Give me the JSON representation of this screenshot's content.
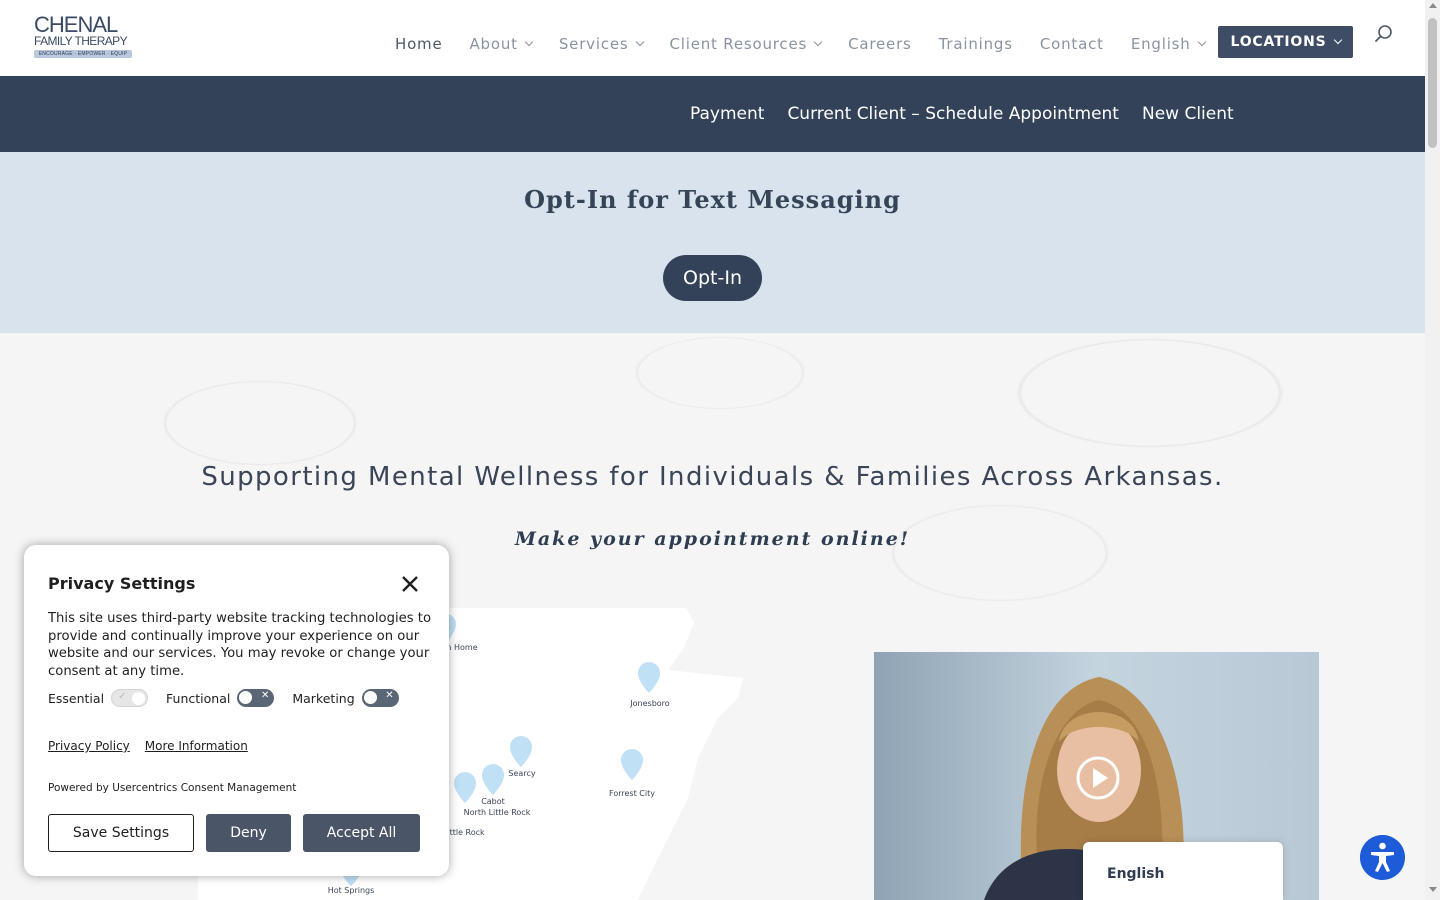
{
  "header": {
    "logo": {
      "line1": "CHENAL",
      "line2": "FAMILY THERAPY",
      "tagline": "ENCOURAGE · EMPOWER · EQUIP"
    },
    "nav": [
      {
        "label": "Home",
        "has_dropdown": false,
        "active": true
      },
      {
        "label": "About",
        "has_dropdown": true
      },
      {
        "label": "Services",
        "has_dropdown": true
      },
      {
        "label": "Client Resources",
        "has_dropdown": true
      },
      {
        "label": "Careers",
        "has_dropdown": false
      },
      {
        "label": "Trainings",
        "has_dropdown": false
      },
      {
        "label": "Contact",
        "has_dropdown": false
      },
      {
        "label": "English",
        "has_dropdown": true
      }
    ],
    "locations_label": "LOCATIONS",
    "search_icon": "search-icon"
  },
  "subnav": {
    "links": [
      "Payment",
      "Current Client – Schedule Appointment",
      "New Client"
    ]
  },
  "optin": {
    "title": "Opt-In for Text Messaging",
    "button": "Opt-In"
  },
  "hero": {
    "title": "Supporting Mental Wellness for Individuals & Families Across Arkansas.",
    "subtitle": "Make your appointment online!"
  },
  "map": {
    "locations": [
      {
        "label": "n Home"
      },
      {
        "label": "Jonesboro"
      },
      {
        "label": "Searcy"
      },
      {
        "label": "Cabot"
      },
      {
        "label": "North Little Rock"
      },
      {
        "label": "Forrest City"
      },
      {
        "label": "ittle Rock"
      },
      {
        "label": "Hot Springs"
      }
    ],
    "pin_color": "#bfe0f5"
  },
  "video": {
    "play_icon": "play-icon"
  },
  "language_widget": {
    "current": "English"
  },
  "accessibility": {
    "icon": "accessibility-icon",
    "color": "#1e5bd8"
  },
  "privacy": {
    "title": "Privacy Settings",
    "body": "This site uses third-party website tracking technologies to provide and continually improve your experience on our website and our services. You may revoke or change your consent at any time.",
    "toggles": [
      {
        "label": "Essential",
        "state": "on",
        "disabled": true
      },
      {
        "label": "Functional",
        "state": "off"
      },
      {
        "label": "Marketing",
        "state": "off"
      }
    ],
    "links": [
      "Privacy Policy",
      "More Information"
    ],
    "powered_by": "Powered by Usercentrics Consent Management",
    "buttons": {
      "save": "Save Settings",
      "deny": "Deny",
      "accept": "Accept All"
    }
  },
  "colors": {
    "navy": "#344259",
    "optin_bg": "#d8e3ee",
    "nav_text": "#8a93a0"
  }
}
